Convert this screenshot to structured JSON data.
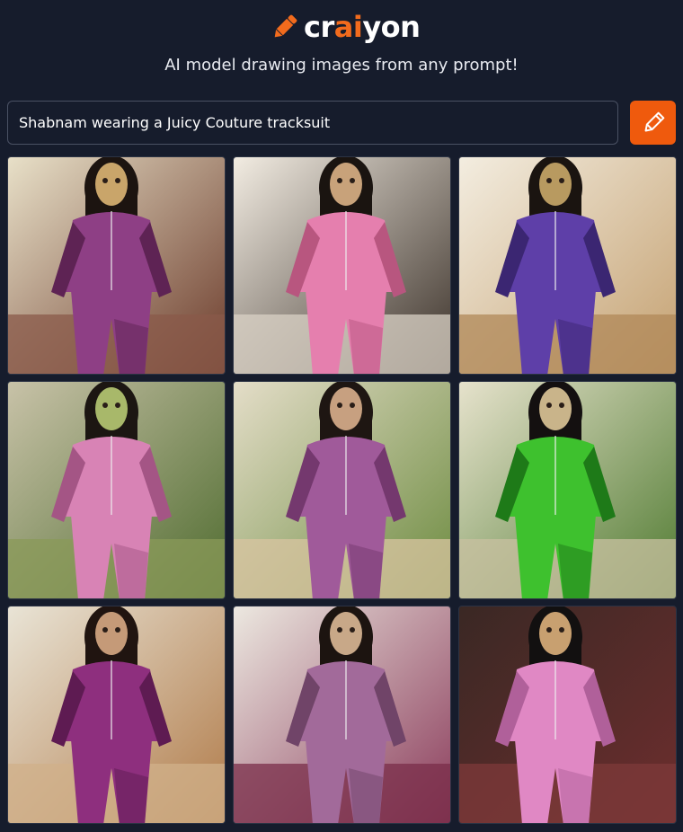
{
  "brand": {
    "name_prefix": "cr",
    "name_accent": "ai",
    "name_suffix": "yon",
    "accent_color": "#f26b1d",
    "icon": "pencil-icon"
  },
  "tagline": "AI model drawing images from any prompt!",
  "prompt": {
    "value": "Shabnam wearing a Juicy Couture tracksuit",
    "button_icon": "pencil-icon",
    "button_color": "#ef5a0d"
  },
  "images": [
    {
      "bg1": "#e8e0c8",
      "bg2": "#6b3a2a",
      "floor": "#8a5a4a",
      "suit": "#8e3f85",
      "suit_dark": "#5e2354",
      "skin": "#c9a56a",
      "hair": "#1c1410"
    },
    {
      "bg1": "#f2ece2",
      "bg2": "#3a3028",
      "floor": "#d9d2c6",
      "suit": "#e57fae",
      "suit_dark": "#b8567f",
      "skin": "#c8a27a",
      "hair": "#1a1410"
    },
    {
      "bg1": "#f3ede0",
      "bg2": "#c4a070",
      "floor": "#b08858",
      "suit": "#5e3fa8",
      "suit_dark": "#3b2672",
      "skin": "#b89a60",
      "hair": "#1a1410"
    },
    {
      "bg1": "#c8c2a8",
      "bg2": "#4e6b2e",
      "floor": "#8a9a58",
      "suit": "#d883b5",
      "suit_dark": "#a45585",
      "skin": "#a8b86a",
      "hair": "#1c1612"
    },
    {
      "bg1": "#e4ddc8",
      "bg2": "#6b8a3e",
      "floor": "#d8c4a0",
      "suit": "#a05a9a",
      "suit_dark": "#74386e",
      "skin": "#c7a080",
      "hair": "#1e1612"
    },
    {
      "bg1": "#e6e2cc",
      "bg2": "#4f7a30",
      "floor": "#c8c0a0",
      "suit": "#3ec12e",
      "suit_dark": "#1e7a18",
      "skin": "#c9b48a",
      "hair": "#141010"
    },
    {
      "bg1": "#e9e4d6",
      "bg2": "#b07a48",
      "floor": "#d0b08a",
      "suit": "#8e2f7e",
      "suit_dark": "#5e1b52",
      "skin": "#c59a78",
      "hair": "#201410"
    },
    {
      "bg1": "#ece8e0",
      "bg2": "#8a3a5a",
      "floor": "#7a2e4a",
      "suit": "#a26a9a",
      "suit_dark": "#704468",
      "skin": "#c8a888",
      "hair": "#1c1410"
    },
    {
      "bg1": "#3a2824",
      "bg2": "#6e2e2e",
      "floor": "#7e3a3a",
      "suit": "#e088c4",
      "suit_dark": "#b0609a",
      "skin": "#c8a070",
      "hair": "#121010"
    }
  ]
}
